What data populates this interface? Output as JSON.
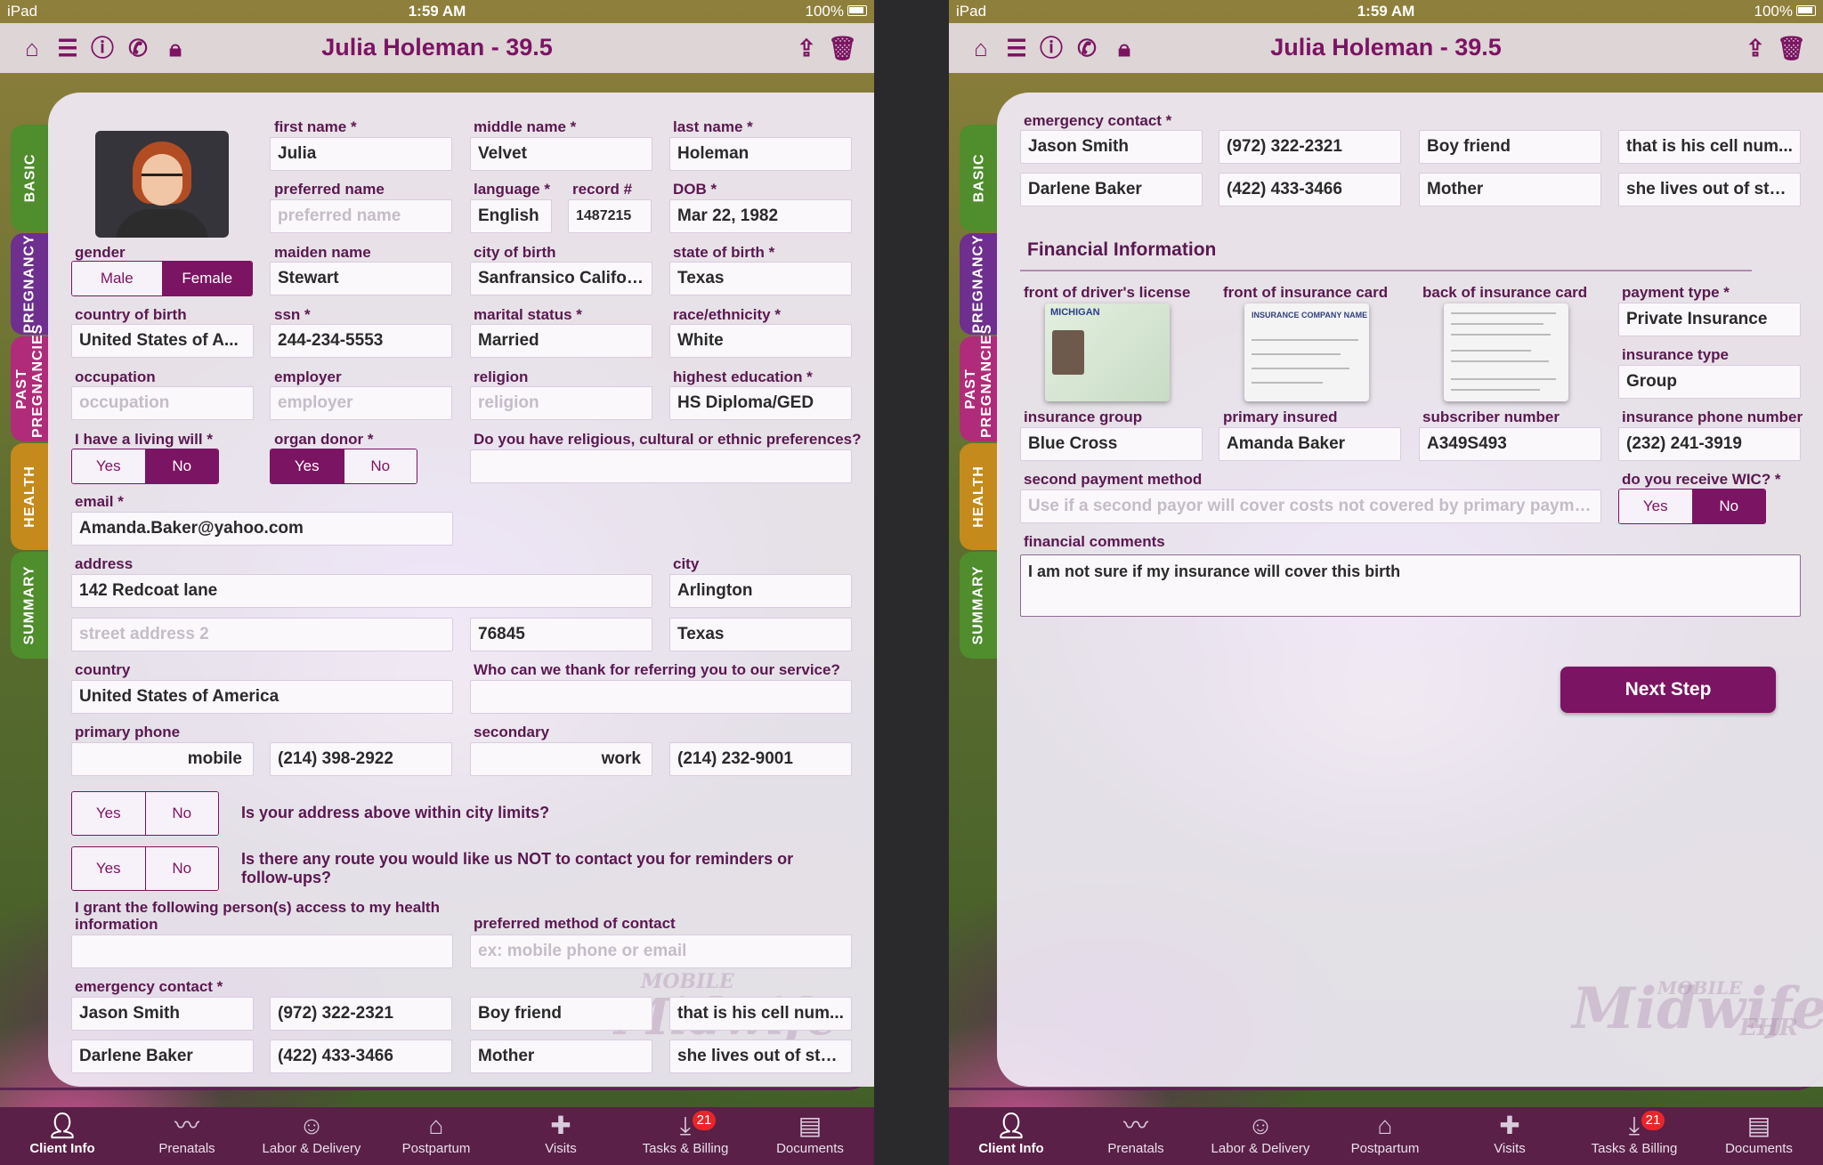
{
  "status": {
    "device": "iPad",
    "time": "1:59 AM",
    "battery": "100%"
  },
  "nav": {
    "title": "Julia Holeman - 39.5"
  },
  "sidetabs": [
    "BASIC",
    "PREGNANCY",
    "PAST PREGNANCIES",
    "HEALTH",
    "SUMMARY"
  ],
  "colors": {
    "accent": "#7b1462",
    "tab_basic": "#4f8d2d",
    "tab_pregnancy": "#6e2f8f",
    "tab_past": "#b02c7a",
    "tab_health": "#c48a1c",
    "tab_summary": "#4f8d2d"
  },
  "icons": [
    "home-icon",
    "list-icon",
    "info-icon",
    "phone-icon",
    "lock-icon",
    "share-icon",
    "trash-icon"
  ],
  "basic": {
    "first_name": {
      "label": "first name *",
      "value": "Julia"
    },
    "middle_name": {
      "label": "middle name *",
      "value": "Velvet"
    },
    "last_name": {
      "label": "last name *",
      "value": "Holeman"
    },
    "preferred_name": {
      "label": "preferred name",
      "placeholder": "preferred name"
    },
    "language": {
      "label": "language *",
      "value": "English"
    },
    "record": {
      "label": "record #",
      "value": "1487215"
    },
    "dob": {
      "label": "DOB *",
      "value": "Mar 22, 1982"
    },
    "gender": {
      "label": "gender",
      "options": [
        "Male",
        "Female"
      ],
      "selected": "Female"
    },
    "maiden_name": {
      "label": "maiden name",
      "value": "Stewart"
    },
    "city_of_birth": {
      "label": "city of birth",
      "value": "Sanfransico Califor..."
    },
    "state_of_birth": {
      "label": "state of birth *",
      "value": "Texas"
    },
    "country_of_birth": {
      "label": "country of birth",
      "value": "United States of A..."
    },
    "ssn": {
      "label": "ssn *",
      "value": "244-234-5553"
    },
    "marital_status": {
      "label": "marital status *",
      "value": "Married"
    },
    "race": {
      "label": "race/ethnicity *",
      "value": "White"
    },
    "occupation": {
      "label": "occupation",
      "placeholder": "occupation"
    },
    "employer": {
      "label": "employer",
      "placeholder": "employer"
    },
    "religion": {
      "label": "religion",
      "placeholder": "religion"
    },
    "education": {
      "label": "highest education *",
      "value": "HS Diploma/GED"
    },
    "living_will": {
      "label": "I have a living will *",
      "options": [
        "Yes",
        "No"
      ],
      "selected": "No"
    },
    "organ_donor": {
      "label": "organ donor *",
      "options": [
        "Yes",
        "No"
      ],
      "selected": "Yes"
    },
    "preferences": {
      "label": "Do you have religious, cultural or ethnic preferences?",
      "value": ""
    },
    "email": {
      "label": "email *",
      "value": "Amanda.Baker@yahoo.com"
    },
    "address": {
      "label": "address",
      "value": "142 Redcoat lane"
    },
    "city": {
      "label": "city",
      "value": "Arlington"
    },
    "street2": {
      "placeholder": "street address 2"
    },
    "zip": {
      "value": "76845"
    },
    "state": {
      "value": "Texas"
    },
    "country": {
      "label": "country",
      "value": "United States of America"
    },
    "referral": {
      "label": "Who can we thank for referring you to our service?",
      "value": ""
    },
    "primary_phone": {
      "label": "primary phone",
      "type": "mobile",
      "value": "(214) 398-2922"
    },
    "secondary_phone": {
      "label": "secondary",
      "type": "work",
      "value": "(214) 232-9001"
    },
    "city_limits": {
      "question": "Is your address above within city limits?",
      "options": [
        "Yes",
        "No"
      ]
    },
    "no_contact": {
      "question": "Is there any route you would like us NOT to contact you for reminders or follow-ups?",
      "options": [
        "Yes",
        "No"
      ]
    },
    "access": {
      "label": "I grant the following person(s) access to my health information",
      "value": ""
    },
    "contact_method": {
      "label": "preferred method of contact",
      "placeholder": "ex: mobile phone or email"
    },
    "emergency": {
      "label": "emergency contact *",
      "rows": [
        [
          "Jason Smith",
          "(972) 322-2321",
          "Boy friend",
          "that is his cell num..."
        ],
        [
          "Darlene Baker",
          "(422) 433-3466",
          "Mother",
          "she lives out of state"
        ]
      ]
    }
  },
  "financial": {
    "emergency": {
      "label": "emergency contact *",
      "rows": [
        [
          "Jason Smith",
          "(972) 322-2321",
          "Boy friend",
          "that is his cell num..."
        ],
        [
          "Darlene Baker",
          "(422) 433-3466",
          "Mother",
          "she lives out of state"
        ]
      ]
    },
    "section_title": "Financial Information",
    "dl_label": "front of driver's license",
    "dl_header": "MICHIGAN",
    "ins_front_label": "front of insurance card",
    "ins_front_header": "INSURANCE COMPANY NAME",
    "ins_back_label": "back of insurance card",
    "payment_type": {
      "label": "payment type *",
      "value": "Private Insurance"
    },
    "insurance_type": {
      "label": "insurance type",
      "value": "Group"
    },
    "insurance_group": {
      "label": "insurance group",
      "value": "Blue Cross"
    },
    "primary_insured": {
      "label": "primary insured",
      "value": "Amanda Baker"
    },
    "subscriber_number": {
      "label": "subscriber number",
      "value": "A349S493"
    },
    "insurance_phone": {
      "label": "insurance phone number",
      "value": "(232) 241-3919"
    },
    "second_payment": {
      "label": "second payment method",
      "placeholder": "Use if a second payor will cover costs not covered by primary payment..."
    },
    "wic": {
      "label": "do you receive WIC? *",
      "options": [
        "Yes",
        "No"
      ],
      "selected": "No"
    },
    "comments": {
      "label": "financial comments",
      "value": "I am not sure if my insurance will cover this birth"
    },
    "next_button": "Next Step"
  },
  "watermark": {
    "line1": "MOBILE",
    "line2": "Midwife",
    "line3": "EHR"
  },
  "tabbar": [
    {
      "label": "Client Info",
      "icon": "person-icon"
    },
    {
      "label": "Prenatals",
      "icon": "pulse-icon"
    },
    {
      "label": "Labor & Delivery",
      "icon": "baby-icon"
    },
    {
      "label": "Postpartum",
      "icon": "house-icon"
    },
    {
      "label": "Visits",
      "icon": "medkit-icon"
    },
    {
      "label": "Tasks & Billing",
      "icon": "inbox-icon",
      "badge": "21"
    },
    {
      "label": "Documents",
      "icon": "cabinet-icon"
    }
  ]
}
